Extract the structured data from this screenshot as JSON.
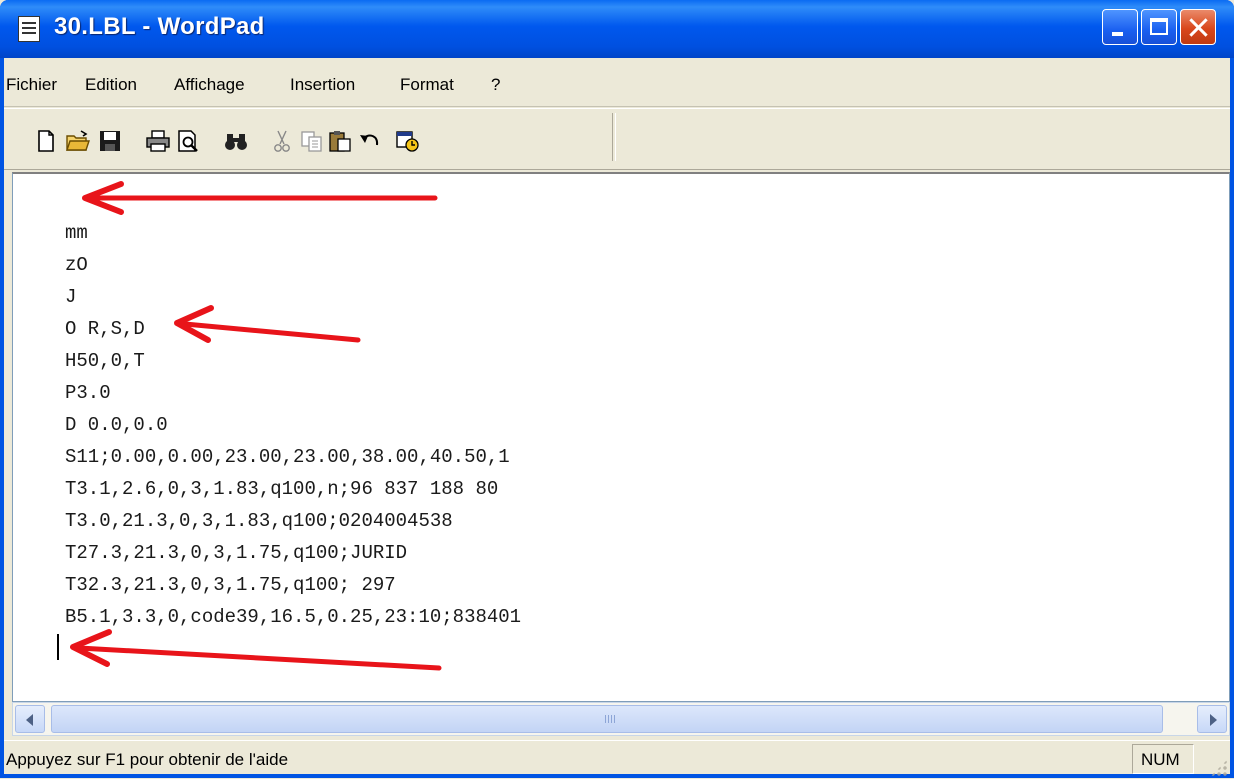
{
  "window": {
    "title": "30.LBL - WordPad"
  },
  "menu": {
    "items": [
      "Fichier",
      "Edition",
      "Affichage",
      "Insertion",
      "Format",
      "?"
    ]
  },
  "toolbar": {
    "buttons": [
      {
        "icon": "new-document-icon"
      },
      {
        "icon": "open-folder-icon"
      },
      {
        "icon": "save-disk-icon"
      },
      {
        "icon": "print-icon"
      },
      {
        "icon": "print-preview-icon"
      },
      {
        "icon": "find-binoculars-icon"
      },
      {
        "icon": "cut-scissors-icon"
      },
      {
        "icon": "copy-icon"
      },
      {
        "icon": "paste-icon"
      },
      {
        "icon": "undo-icon"
      },
      {
        "icon": "insert-date-time-icon"
      }
    ]
  },
  "document": {
    "lines": [
      "mm",
      "zO",
      "J",
      "O R,S,D",
      "H50,0,T",
      "P3.0",
      "D 0.0,0.0",
      "S11;0.00,0.00,23.00,23.00,38.00,40.50,1",
      "T3.1,2.6,0,3,1.83,q100,n;96 837 188 80",
      "T3.0,21.3,0,3,1.83,q100;0204004538",
      "T27.3,21.3,0,3,1.75,q100;JURID",
      "T32.3,21.3,0,3,1.75,q100; 297",
      "B5.1,3.3,0,code39,16.5,0.25,23:10;838401"
    ],
    "annotation_color": "#e8141a"
  },
  "statusbar": {
    "help_text": "Appuyez sur F1 pour obtenir de l'aide",
    "num_indicator": "NUM"
  }
}
